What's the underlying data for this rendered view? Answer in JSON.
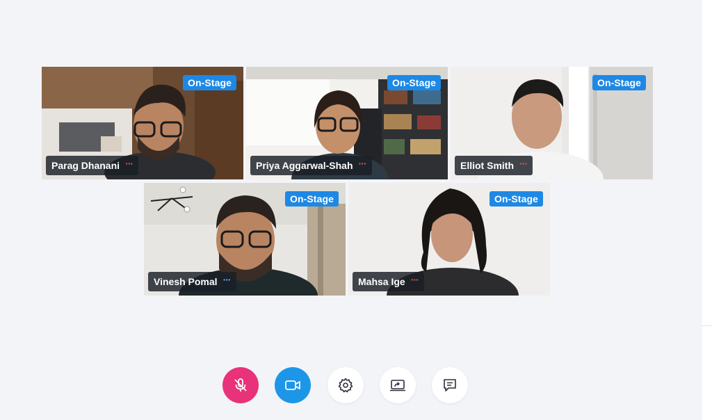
{
  "participants": [
    {
      "name": "Parag Dhanani",
      "badge": "On-Stage",
      "menu": "···"
    },
    {
      "name": "Priya Aggarwal-Shah",
      "badge": "On-Stage",
      "menu": "···"
    },
    {
      "name": "Elliot Smith",
      "badge": "On-Stage",
      "menu": "···"
    },
    {
      "name": "Vinesh Pomal",
      "badge": "On-Stage",
      "menu": "···"
    },
    {
      "name": "Mahsa Ige",
      "badge": "On-Stage",
      "menu": "···"
    }
  ],
  "controls": [
    {
      "icon": "mic-off-icon",
      "color": "#e8327a"
    },
    {
      "icon": "video-camera-icon",
      "color": "#1e96e8"
    },
    {
      "icon": "gear-icon",
      "color": "#ffffff"
    },
    {
      "icon": "screen-share-icon",
      "color": "#ffffff"
    },
    {
      "icon": "chat-icon",
      "color": "#ffffff"
    }
  ],
  "colors": {
    "accent": "#1e88e5",
    "background": "#f3f4f8"
  }
}
